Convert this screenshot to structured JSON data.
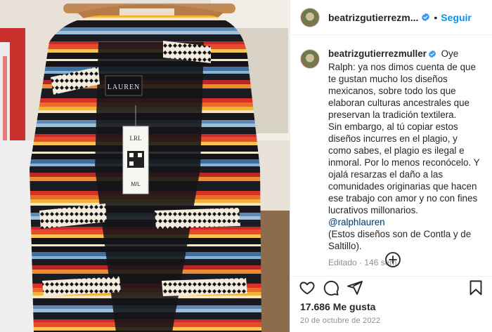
{
  "post": {
    "username": "beatrizgutierrezm...",
    "follow_label": "Seguir",
    "separator": "•"
  },
  "caption": {
    "username": "beatrizgutierrezmuller",
    "lines": [
      "Oye Ralph: ya nos dimos cuenta de que te gustan mucho los diseños mexicanos, sobre todo los que elaboran culturas ancestrales que preservan la tradición textilera.",
      "Sin embargo, al tú copiar estos diseños incurres en el plagio, y como sabes, el plagio es ilegal e inmoral. Por lo menos reconócelo. Y ojalá resarzas el daño a las comunidades originarias que hacen ese trabajo con amor y no con fines lucrativos millonarios."
    ],
    "mention": "@ralphlauren",
    "closing": "(Estos diseños son de Contla y de Saltillo).",
    "meta": "Editado · 146 sem"
  },
  "likes": "17.686 Me gusta",
  "date": "20 de octubre de 2022",
  "photo": {
    "label_brand": "LAUREN",
    "hanger_text": "RALPH LAUREN",
    "tag_text": "LRL",
    "tag_size": "M/L"
  },
  "colors": {
    "accent": "#0095f6",
    "verified": "#3897f0",
    "mention": "#00376b",
    "muted": "#8e8e8e"
  },
  "icons": {
    "verified": "verified-badge-icon",
    "add_comments": "plus-circle-icon",
    "like": "heart-icon",
    "comment": "comment-icon",
    "share": "share-icon",
    "save": "bookmark-icon"
  }
}
